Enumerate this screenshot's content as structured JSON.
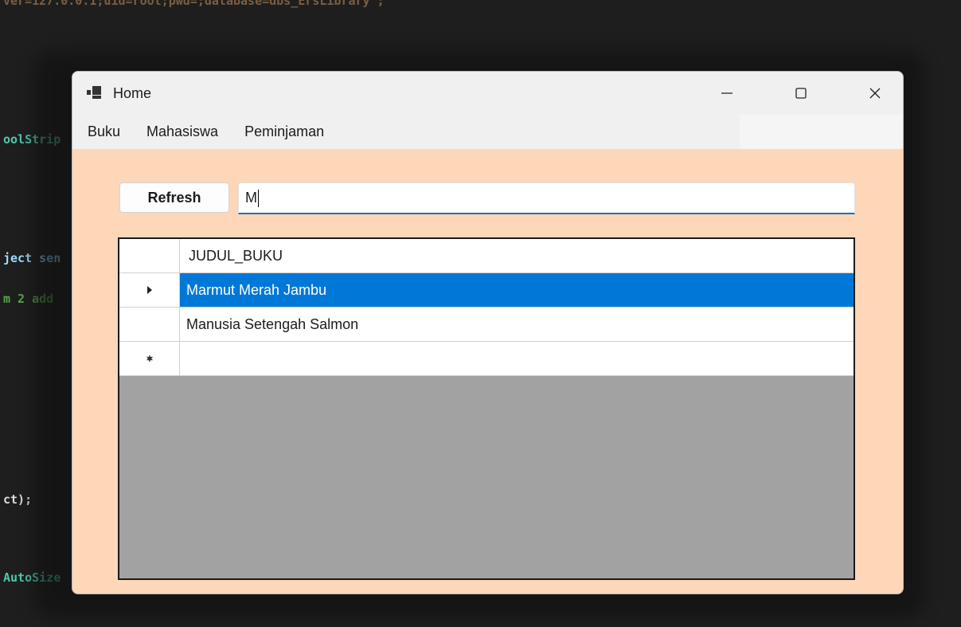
{
  "window": {
    "title": "Home"
  },
  "menu": {
    "items": [
      "Buku",
      "Mahasiswa",
      "Peminjaman"
    ]
  },
  "toolbar": {
    "refresh_label": "Refresh"
  },
  "search": {
    "value": "M"
  },
  "grid": {
    "columns": [
      "JUDUL_BUKU"
    ],
    "rows": [
      {
        "judul_buku": "Marmut Merah Jambu",
        "selected": true
      },
      {
        "judul_buku": "Manusia Setengah Salmon",
        "selected": false
      }
    ],
    "new_row": ""
  },
  "background_code": {
    "line_top": "ver=127.0.0.1;uid=root;pwd=;database=dbs_ErsLibrary\";",
    "line1": "oolStrip",
    "line2_a": "ject ",
    "line2_b": "sen",
    "line3": "m 2 add",
    "line4": "ct);",
    "line5": "AutoSize"
  },
  "colors": {
    "form_background": "#fdd7b7",
    "selection": "#0078d7",
    "grid_empty": "#a2a2a2",
    "input_focus": "#1f6fb6"
  },
  "icons": {
    "app": "form-icon",
    "minimize": "minimize-icon",
    "maximize": "maximize-icon",
    "close": "close-icon",
    "current_row": "row-pointer-icon",
    "new_row": "new-row-asterisk-icon"
  }
}
